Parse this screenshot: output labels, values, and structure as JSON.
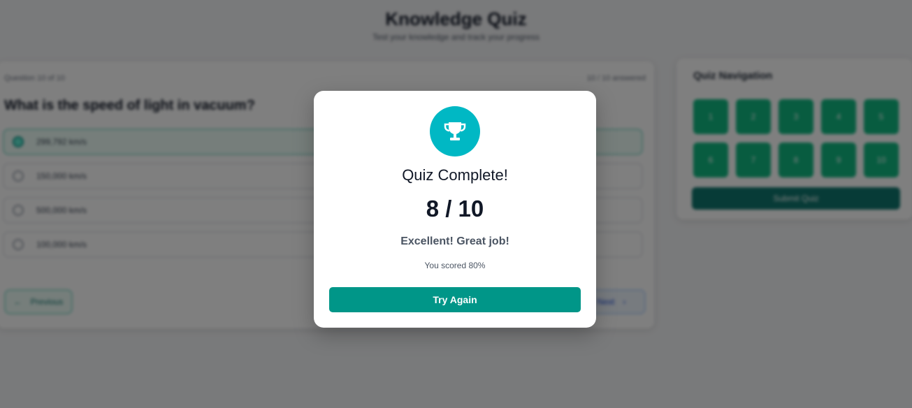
{
  "header": {
    "title": "Knowledge Quiz",
    "subtitle": "Test your knowledge and track your progress"
  },
  "quiz": {
    "question_counter": "Question 10 of 10",
    "answered_counter": "10 / 10 answered",
    "question": "What is the speed of light in vacuum?",
    "options": [
      {
        "label": "299,792 km/s",
        "selected": true
      },
      {
        "label": "150,000 km/s",
        "selected": false
      },
      {
        "label": "500,000 km/s",
        "selected": false
      },
      {
        "label": "100,000 km/s",
        "selected": false
      }
    ],
    "previous_label": "Previous",
    "next_label": "Next"
  },
  "navigation": {
    "title": "Quiz Navigation",
    "buttons": [
      "1",
      "2",
      "3",
      "4",
      "5",
      "6",
      "7",
      "8",
      "9",
      "10"
    ],
    "submit_label": "Submit Quiz"
  },
  "modal": {
    "icon": "trophy-icon",
    "title": "Quiz Complete!",
    "score": "8 / 10",
    "message": "Excellent! Great job!",
    "percent_text": "You scored 80%",
    "button_label": "Try Again"
  },
  "colors": {
    "accent": "#009688",
    "trophy_bg": "#00b8c4",
    "nav_button": "#10b981"
  }
}
